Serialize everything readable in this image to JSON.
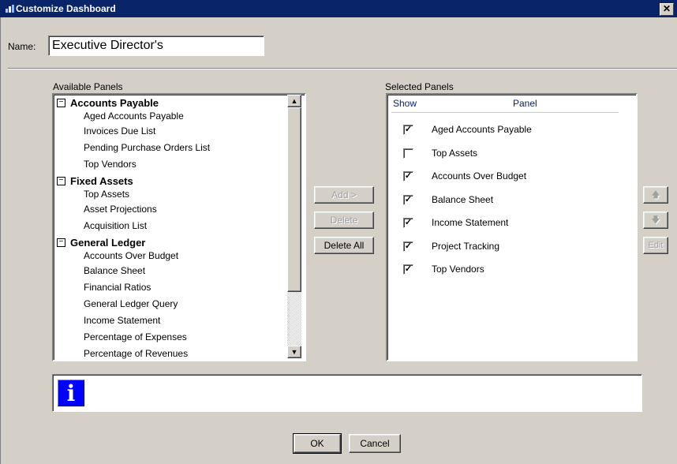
{
  "window": {
    "title": "Customize Dashboard",
    "close_glyph": "✕",
    "icon": "dashboard-icon"
  },
  "name_field": {
    "label": "Name:",
    "value": "Executive Director's"
  },
  "available": {
    "label": "Available Panels",
    "groups": [
      {
        "toggle": "−",
        "label": "Accounts Payable",
        "items": [
          "Aged Accounts Payable",
          "Invoices Due List",
          "Pending Purchase Orders List",
          "Top Vendors"
        ]
      },
      {
        "toggle": "−",
        "label": "Fixed Assets",
        "items": [
          "Top Assets",
          "Asset Projections",
          "Acquisition List"
        ]
      },
      {
        "toggle": "−",
        "label": "General Ledger",
        "items": [
          "Accounts Over Budget",
          "Balance Sheet",
          "Financial Ratios",
          "General Ledger Query",
          "Income Statement",
          "Percentage of Expenses",
          "Percentage of Revenues"
        ]
      }
    ]
  },
  "middle_buttons": {
    "add": "Add >",
    "delete": "Delete",
    "delete_all": "Delete All"
  },
  "selected": {
    "label": "Selected Panels",
    "col_show": "Show",
    "col_panel": "Panel",
    "rows": [
      {
        "checked": true,
        "mark": "✓",
        "panel": "Aged Accounts Payable"
      },
      {
        "checked": false,
        "mark": "",
        "panel": "Top Assets"
      },
      {
        "checked": true,
        "mark": "✓",
        "panel": "Accounts Over Budget"
      },
      {
        "checked": true,
        "mark": "✓",
        "panel": "Balance Sheet"
      },
      {
        "checked": true,
        "mark": "✓",
        "panel": "Income Statement"
      },
      {
        "checked": true,
        "mark": "✓",
        "panel": "Project Tracking"
      },
      {
        "checked": true,
        "mark": "✓",
        "panel": "Top Vendors"
      }
    ]
  },
  "side_buttons": {
    "up_glyph": "🡅",
    "down_glyph": "🡇",
    "edit": "Edit"
  },
  "scroll": {
    "up_glyph": "▲",
    "down_glyph": "▼"
  },
  "info": {
    "glyph": "i",
    "icon": "info-icon"
  },
  "footer": {
    "ok": "OK",
    "cancel": "Cancel"
  },
  "colors": {
    "titlebar": "#0a246a",
    "face": "#d4d0c8",
    "info_blue": "#0000ff"
  }
}
